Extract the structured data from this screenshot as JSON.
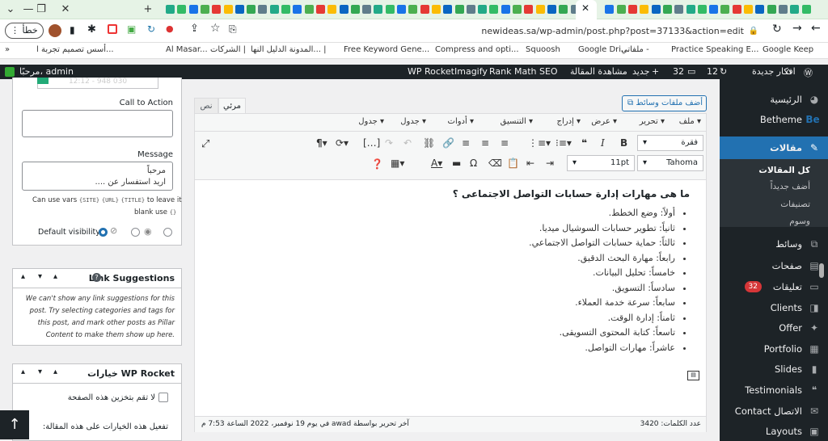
{
  "browser": {
    "url": "newideas.sa/wp-admin/post.php?post=37133&action=edit",
    "profile_label": "خطأ",
    "bookmarks": [
      "أسس تصميم تجربة ا...",
      "Al Masar...",
      "الشركات |",
      "المدونة الدليل النها... |",
      "Free Keyword Gene...",
      "Compress and opti...",
      "Squoosh",
      "Google Dri...",
      "ملفاتي -",
      "Practice Speaking E...",
      "Google Keep"
    ]
  },
  "admin_bar": {
    "greeting": "مرحبًا، admin",
    "rocket": "WP Rocket",
    "imagify": "Imagify",
    "rankmath": "Rank Math SEO",
    "view_post": "مشاهدة المقالة",
    "new": "جديد",
    "comments": "32",
    "updates": "12",
    "site": "افكار جديدة"
  },
  "sidebar": {
    "items": [
      {
        "label": "الرئيسية",
        "icon": "dashboard-icon"
      },
      {
        "label": "Betheme",
        "icon": "be-icon"
      },
      {
        "label": "مقالات",
        "icon": "pin-icon",
        "active": true
      },
      {
        "label": "كل المقالات",
        "sub": true,
        "current": true
      },
      {
        "label": "أضف جديداً",
        "sub": true
      },
      {
        "label": "تصنيفات",
        "sub": true
      },
      {
        "label": "وسوم",
        "sub": true
      },
      {
        "label": "وسائط",
        "icon": "media-icon"
      },
      {
        "label": "صفحات",
        "icon": "pages-icon"
      },
      {
        "label": "تعليقات",
        "icon": "comments-icon",
        "badge": "32"
      },
      {
        "label": "Clients",
        "icon": "clients-icon"
      },
      {
        "label": "Offer",
        "icon": "offer-icon"
      },
      {
        "label": "Portfolio",
        "icon": "portfolio-icon"
      },
      {
        "label": "Slides",
        "icon": "slides-icon"
      },
      {
        "label": "Testimonials",
        "icon": "testimonials-icon"
      },
      {
        "label": "الاتصال Contact",
        "icon": "contact-icon"
      },
      {
        "label": "Layouts",
        "icon": "layouts-icon"
      }
    ]
  },
  "meta": {
    "time_placeholder": "12:12 - 948 030",
    "cta_label": "Call to Action",
    "message_label": "Message",
    "message_value": "مرحباً\nاريد استفسار عن ....",
    "vars_note_1": "Can use vars",
    "vars": [
      "{SITE}",
      "{URL}",
      "{TITLE}"
    ],
    "vars_note_2": "to leave it",
    "vars_note_3": "blank use",
    "vars_note_4": "{}",
    "visibility_label": "Default visibility",
    "link_suggestions_title": "Link Suggestions",
    "link_suggestions_text": "We can't show any link suggestions for this post. Try selecting categories and tags for this post, and mark other posts as Pillar Content to make them show up here.",
    "rocket_title": "خيارات WP Rocket",
    "rocket_option": "لا تقم بتخزين هذه الصفحة",
    "rocket_note": "تفعيل هذه الخيارات على هذه المقالة:"
  },
  "editor": {
    "add_media": "أضف ملفات وسائط",
    "tab_visual": "مرئي",
    "tab_text": "نص",
    "menus": [
      "ملف",
      "تحرير",
      "عرض",
      "إدراج",
      "التنسيق",
      "أدوات",
      "جدول",
      "جدول"
    ],
    "format_select": "فقرة",
    "font_size": "11pt",
    "font_family": "Tahoma",
    "heading": "ما هى مهارات إدارة حسابات التواصل الاجتماعى ؟",
    "list": [
      "أولاً: وضع الخطط.",
      "ثانياً: تطوير حسابات السوشيال ميديا.",
      "ثالثاً: حماية حسابات التواصل الاجتماعي.",
      "رابعاً: مهارة البحث الدقيق.",
      "خامساً: تحليل البيانات.",
      "سادساً: التسويق.",
      "سابعاً: سرعة خدمة العملاء.",
      "ثامناً: إدارة الوقت.",
      "تاسعاً: كتابة المحتوى التسويقى.",
      "عاشراً: مهارات التواصل."
    ],
    "word_count": "عدد الكلمات: 3420",
    "last_edit": "آخر تحرير بواسطة awad في يوم 19 نوفمبر، 2022 الساعة 7:53 م"
  },
  "colors": {
    "admin_bg": "#1d2327",
    "accent": "#2271b1",
    "badge": "#d63638"
  }
}
